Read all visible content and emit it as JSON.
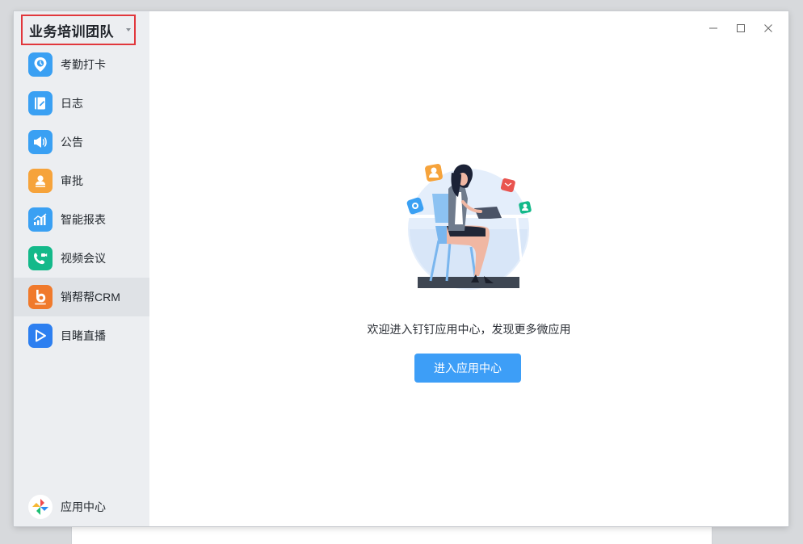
{
  "team": {
    "name": "业务培训团队"
  },
  "nav": {
    "items": [
      {
        "label": "考勤打卡",
        "icon": "location-clock-icon",
        "color": "#3aa0f3"
      },
      {
        "label": "日志",
        "icon": "journal-icon",
        "color": "#3aa0f3"
      },
      {
        "label": "公告",
        "icon": "megaphone-icon",
        "color": "#3aa0f3"
      },
      {
        "label": "审批",
        "icon": "person-stamp-icon",
        "color": "#f6a33b"
      },
      {
        "label": "智能报表",
        "icon": "bar-chart-icon",
        "color": "#3aa0f3"
      },
      {
        "label": "视频会议",
        "icon": "video-phone-icon",
        "color": "#14b98a"
      },
      {
        "label": "销帮帮CRM",
        "icon": "b-logo-icon",
        "color": "#f07a2c"
      },
      {
        "label": "目睹直播",
        "icon": "play-icon",
        "color": "#2d7ff0"
      }
    ],
    "active_index": 6,
    "app_center_label": "应用中心"
  },
  "main": {
    "welcome_text": "欢迎进入钉钉应用中心，发现更多微应用",
    "enter_button_label": "进入应用中心"
  },
  "colors": {
    "accent": "#3d9ef7",
    "highlight_border": "#e1373c"
  }
}
